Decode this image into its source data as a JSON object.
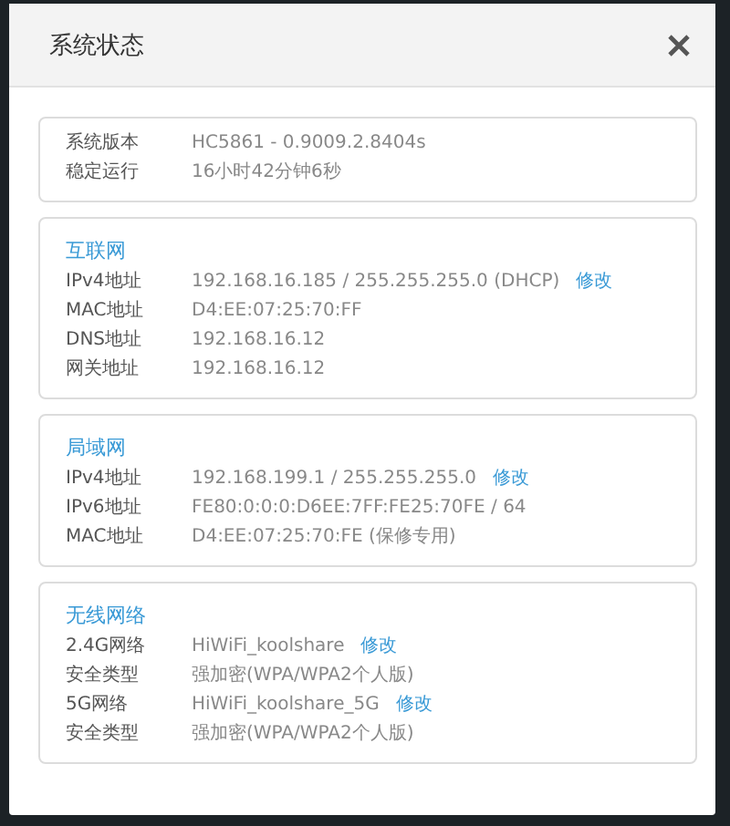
{
  "dialog": {
    "title": "系统状态"
  },
  "sections": [
    {
      "rows": [
        {
          "label": "系统版本",
          "value": "HC5861 - 0.9009.2.8404s"
        },
        {
          "label": "稳定运行",
          "value": "16小时42分钟6秒"
        }
      ]
    },
    {
      "heading": "互联网",
      "rows": [
        {
          "label": "IPv4地址",
          "value": "192.168.16.185 / 255.255.255.0 (DHCP)",
          "link": "修改"
        },
        {
          "label": "MAC地址",
          "value": "D4:EE:07:25:70:FF"
        },
        {
          "label": "DNS地址",
          "value": "192.168.16.12"
        },
        {
          "label": "网关地址",
          "value": "192.168.16.12"
        }
      ]
    },
    {
      "heading": "局域网",
      "rows": [
        {
          "label": "IPv4地址",
          "value": "192.168.199.1 / 255.255.255.0",
          "link": "修改"
        },
        {
          "label": "IPv6地址",
          "value": "FE80:0:0:0:D6EE:7FF:FE25:70FE / 64"
        },
        {
          "label": "MAC地址",
          "value": "D4:EE:07:25:70:FE (保修专用)"
        }
      ]
    },
    {
      "heading": "无线网络",
      "rows": [
        {
          "label": "2.4G网络",
          "value": "HiWiFi_koolshare",
          "link": "修改"
        },
        {
          "label": "安全类型",
          "value": "强加密(WPA/WPA2个人版)"
        },
        {
          "label": "5G网络",
          "value": "HiWiFi_koolshare_5G",
          "link": "修改"
        },
        {
          "label": "安全类型",
          "value": "强加密(WPA/WPA2个人版)"
        }
      ]
    }
  ]
}
